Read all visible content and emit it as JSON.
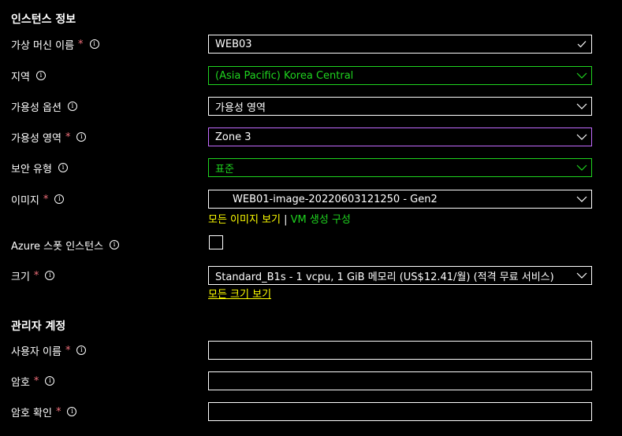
{
  "sections": {
    "instance_details": "인스턴스 정보",
    "admin_account": "관리자 계정"
  },
  "fields": {
    "vm_name": {
      "label": "가상 머신 이름",
      "required": "*",
      "value": "WEB03"
    },
    "region": {
      "label": "지역",
      "value": "(Asia Pacific) Korea Central"
    },
    "availability_option": {
      "label": "가용성 옵션",
      "value": "가용성 영역"
    },
    "availability_zone": {
      "label": "가용성 영역",
      "required": "*",
      "value": "Zone 3"
    },
    "security_type": {
      "label": "보안 유형",
      "value": "표준"
    },
    "image": {
      "label": "이미지",
      "required": "*",
      "value": "WEB01-image-20220603121250 - Gen2"
    },
    "azure_spot": {
      "label": "Azure 스폿 인스턴스"
    },
    "size": {
      "label": "크기",
      "required": "*",
      "value": "Standard_B1s - 1 vcpu, 1 GiB 메모리 (US$12.41/월) (적격 무료 서비스)"
    },
    "username": {
      "label": "사용자 이름",
      "required": "*",
      "value": ""
    },
    "password": {
      "label": "암호",
      "required": "*",
      "value": ""
    },
    "confirm_password": {
      "label": "암호 확인",
      "required": "*",
      "value": ""
    }
  },
  "links": {
    "see_all_images": "모든 이미지 보기",
    "separator": " | ",
    "create_vm_image": "VM 생성 구성",
    "see_all_sizes": "모든 크기 보기"
  },
  "icons": {
    "info": "i",
    "chevron": "chevron-down-icon",
    "check": "checkmark-icon"
  }
}
